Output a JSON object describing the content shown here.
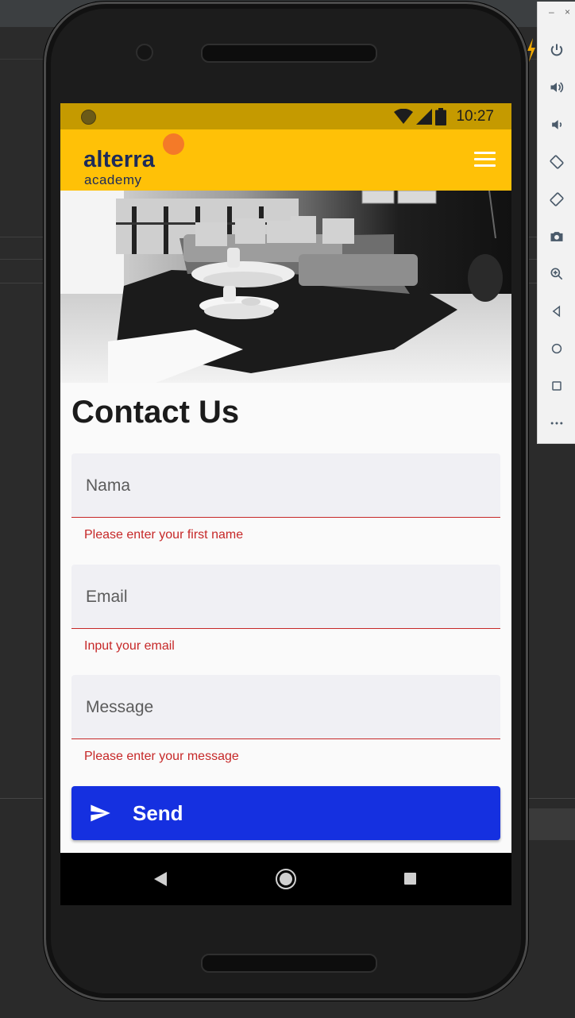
{
  "status_bar": {
    "time": "10:27"
  },
  "app_bar": {
    "logo_word": "alterra",
    "logo_sub": "academy",
    "brand_color": "#1d2b5a",
    "accent_dot_color": "#f47a28",
    "bar_color": "#ffc107",
    "menu_icon": "hamburger-menu-icon"
  },
  "page": {
    "title": "Contact Us"
  },
  "form": {
    "name_placeholder": "Nama",
    "name_error": "Please enter your first name",
    "email_placeholder": "Email",
    "email_error": "Input your email",
    "message_placeholder": "Message",
    "message_error": "Please enter your message",
    "error_color": "#c62828",
    "send_label": "Send",
    "send_color": "#1530e0"
  },
  "nav_bar": {
    "back_icon": "back-triangle-icon",
    "home_icon": "home-circle-icon",
    "recent_icon": "recents-square-icon"
  }
}
